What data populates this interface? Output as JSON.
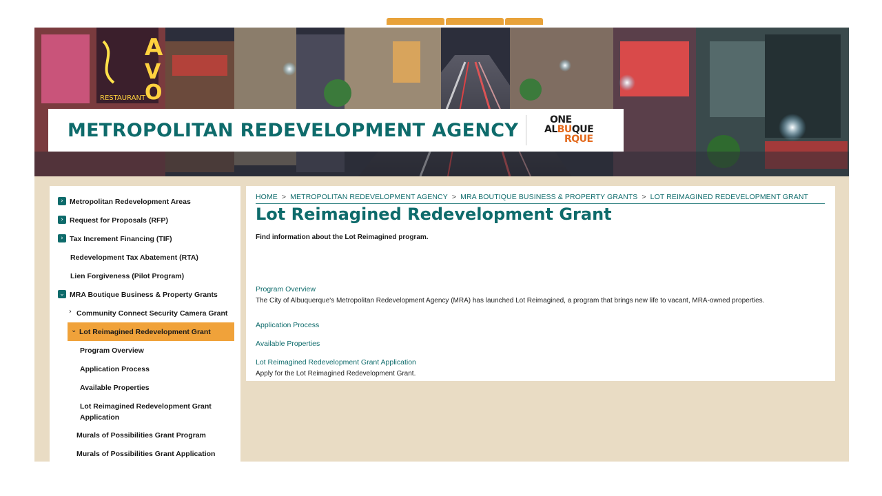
{
  "sidebar": {
    "items": [
      {
        "label": "Metropolitan Redevelopment Areas"
      },
      {
        "label": "Request for Proposals (RFP)"
      },
      {
        "label": "Tax Increment Financing (TIF)"
      },
      {
        "label": "Redevelopment Tax Abatement (RTA)"
      },
      {
        "label": "Lien Forgiveness (Pilot Program)"
      },
      {
        "label": "MRA Boutique Business & Property Grants"
      },
      {
        "label": "Community Connect Security Camera Grant"
      },
      {
        "label": "Lot Reimagined Redevelopment Grant"
      },
      {
        "label": "Program Overview"
      },
      {
        "label": "Application Process"
      },
      {
        "label": "Available Properties"
      },
      {
        "label": "Lot Reimagined Redevelopment Grant",
        "label2": "Application"
      },
      {
        "label": "Murals of Possibilities Grant Program"
      },
      {
        "label": "Murals of Possibilities Grant Application"
      }
    ]
  },
  "header": {
    "title": "METROPOLITAN REDEVELOPMENT AGENCY",
    "logo": {
      "line1": "ONE",
      "line2a": "AL",
      "line2b": "BU",
      "line2c": "QUE",
      "line3": "RQUE"
    }
  },
  "breadcrumb": [
    "HOME",
    "METROPOLITAN REDEVELOPMENT AGENCY",
    "MRA BOUTIQUE BUSINESS & PROPERTY GRANTS",
    "LOT REIMAGINED REDEVELOPMENT GRANT"
  ],
  "breadcrumb_sep": ">",
  "main": {
    "title": "Lot Reimagined Redevelopment Grant",
    "intro": "Find information about the Lot Reimagined program.",
    "sections": [
      {
        "link": "Program Overview",
        "text": "The City of Albuquerque's Metropolitan Redevelopment Agency (MRA) has launched Lot Reimagined, a program that brings new life to vacant, MRA-owned properties."
      },
      {
        "link": "Application Process",
        "text": ""
      },
      {
        "link": "Available Properties",
        "text": ""
      },
      {
        "link": "Lot Reimagined Redevelopment Grant Application",
        "text": "Apply for the Lot Reimagined Redevelopment Grant."
      }
    ]
  },
  "colors": {
    "teal": "#0e6b6b",
    "orange_active": "#f0a23a",
    "background": "#e9dcc4",
    "logo_orange": "#e36a1d"
  },
  "icons": {
    "expand": "chevron-right-icon",
    "collapse": "chevron-down-icon"
  }
}
